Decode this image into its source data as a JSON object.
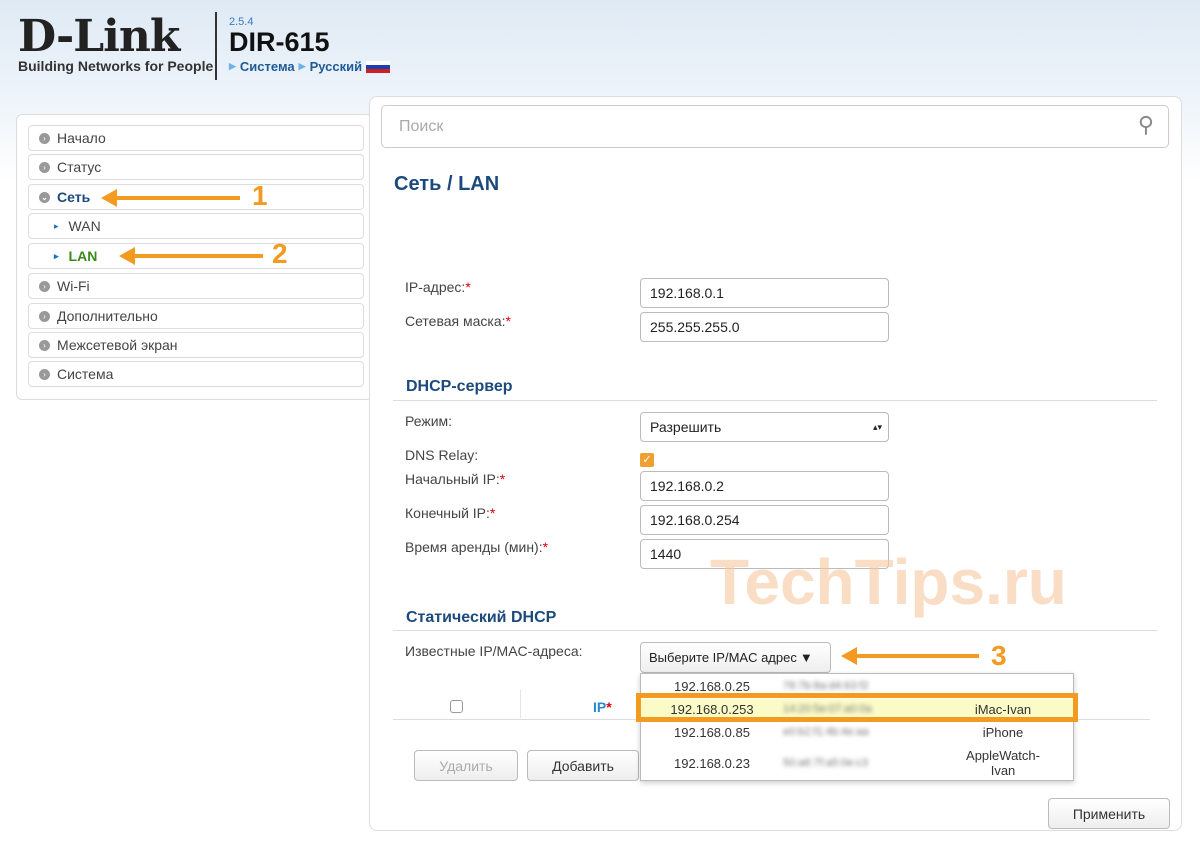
{
  "header": {
    "logo": "D-Link",
    "tagline": "Building Networks for People",
    "version": "2.5.4",
    "model": "DIR-615",
    "crumb_system": "Система",
    "crumb_language": "Русский"
  },
  "sidebar": {
    "items": [
      {
        "label": "Начало"
      },
      {
        "label": "Статус"
      },
      {
        "label": "Сеть"
      },
      {
        "label": "WAN"
      },
      {
        "label": "LAN"
      },
      {
        "label": "Wi-Fi"
      },
      {
        "label": "Дополнительно"
      },
      {
        "label": "Межсетевой экран"
      },
      {
        "label": "Система"
      }
    ]
  },
  "search": {
    "placeholder": "Поиск"
  },
  "page": {
    "title": "Сеть /  LAN"
  },
  "lan": {
    "ip_label": "IP-адрес:",
    "ip": "192.168.0.1",
    "mask_label": "Сетевая маска:",
    "mask": "255.255.255.0"
  },
  "dhcp": {
    "title": "DHCP-сервер",
    "mode_label": "Режим:",
    "mode": "Разрешить",
    "dns_label": "DNS Relay:",
    "dns_checked": true,
    "start_label": "Начальный IP:",
    "start": "192.168.0.2",
    "end_label": "Конечный IP:",
    "end": "192.168.0.254",
    "lease_label": "Время аренды (мин):",
    "lease": "1440"
  },
  "static": {
    "title": "Статический DHCP",
    "known_label": "Известные IP/MAC-адреса:",
    "select": "Выберите IP/MAC адрес",
    "col_ip": "IP",
    "delete": "Удалить",
    "add": "Добавить",
    "options": [
      {
        "ip": "192.168.0.25",
        "mac": "78:7b:8a:d4:63:f2",
        "name": ""
      },
      {
        "ip": "192.168.0.253",
        "mac": "14:20:5e:07:a0:0a",
        "name": "iMac-Ivan"
      },
      {
        "ip": "192.168.0.85",
        "mac": "e0:b2:f1:4b:4e:aa",
        "name": "iPhone"
      },
      {
        "ip": "192.168.0.23",
        "mac": "50:a6:7f:a5:0e:c3",
        "name": "AppleWatch-Ivan"
      }
    ]
  },
  "apply": "Применить",
  "annotations": {
    "n1": "1",
    "n2": "2",
    "n3": "3"
  },
  "watermark": "TechTips.ru",
  "colors": {
    "accent": "#f39a21",
    "title": "#1c4a7c"
  }
}
